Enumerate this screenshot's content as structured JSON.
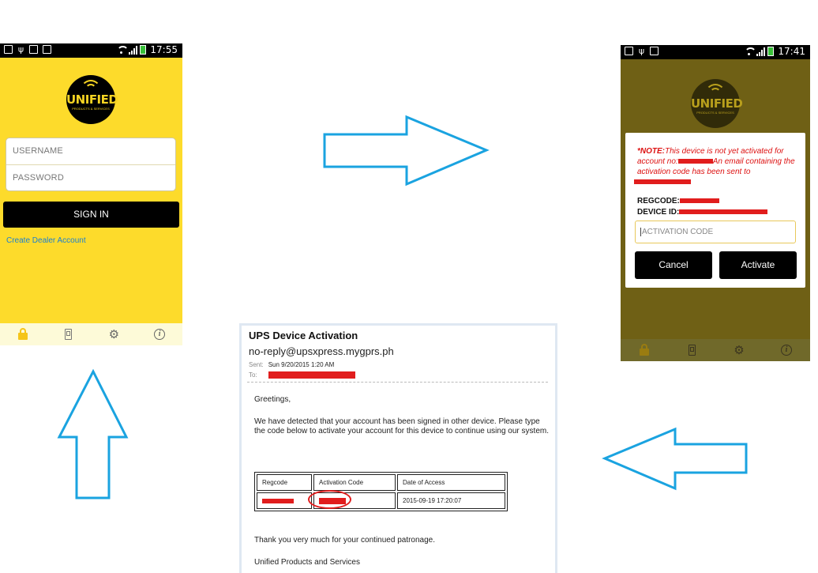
{
  "login_screen": {
    "status": {
      "time": "17:55"
    },
    "logo": {
      "name": "UNIFIED",
      "tagline": "PRODUCTS & SERVICES"
    },
    "username_placeholder": "USERNAME",
    "password_placeholder": "PASSWORD",
    "signin_label": "SIGN IN",
    "dealer_link": "Create Dealer Account",
    "tabs": [
      "lock-icon",
      "mobile-icon",
      "settings-icon",
      "info-icon"
    ]
  },
  "activation_screen": {
    "status": {
      "time": "17:41"
    },
    "logo": {
      "name": "UNIFIED",
      "tagline": "PRODUCTS & SERVICES"
    },
    "note_label": "*NOTE:",
    "note_part1": "This device is not yet activated for account no:",
    "note_part2": "An email containing the activation code has been sent to",
    "regcode_label": "REGCODE:",
    "device_id_label": "DEVICE ID:",
    "activation_placeholder": "ACTIVATION CODE",
    "cancel_label": "Cancel",
    "activate_label": "Activate",
    "tabs": [
      "lock-icon",
      "mobile-icon",
      "settings-icon",
      "info-icon"
    ]
  },
  "email": {
    "subject": "UPS Device Activation",
    "from": "no-reply@upsxpress.mygprs.ph",
    "sent_label": "Sent:",
    "sent_value": "Sun 9/20/2015 1:20 AM",
    "to_label": "To:",
    "greeting": "Greetings,",
    "body": "We have detected that your account has been signed in other device. Please type the code below to activate your account for this device to continue using our system.",
    "table": {
      "headers": [
        "Regcode",
        "Activation Code",
        "Date of Access"
      ],
      "row": {
        "date": "2015-09-19 17:20:07"
      }
    },
    "thanks": "Thank you very much for your continued patronage.",
    "signature": "Unified Products and Services"
  },
  "colors": {
    "app_yellow": "#fddb2b",
    "dimmed_bg": "#6f6015",
    "arrow_blue": "#1aa3e0",
    "redaction": "#e11d1d",
    "link_blue": "#1a7fd1"
  }
}
